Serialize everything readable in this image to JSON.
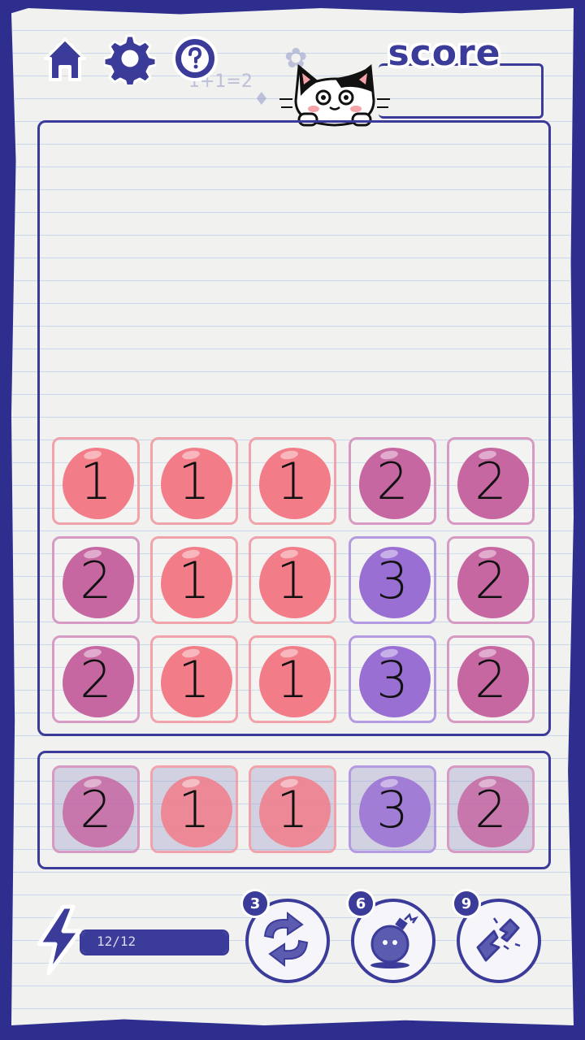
{
  "header": {
    "score_title": "score",
    "score_value": ""
  },
  "colors": {
    "frame": "#2e2e8f",
    "ink": "#3b3b99",
    "tile_1": "#f27c88",
    "tile_2": "#c667a2",
    "tile_3": "#9a6fd4"
  },
  "board": {
    "rows": [
      [
        "1",
        "1",
        "1",
        "2",
        "2"
      ],
      [
        "2",
        "1",
        "1",
        "3",
        "2"
      ],
      [
        "2",
        "1",
        "1",
        "3",
        "2"
      ]
    ]
  },
  "next_row": [
    "2",
    "1",
    "1",
    "3",
    "2"
  ],
  "energy": {
    "label": "12/12",
    "fraction": 1.0
  },
  "powerups": [
    {
      "name": "shuffle",
      "cost": "3",
      "icon": "shuffle-icon"
    },
    {
      "name": "bomb",
      "cost": "6",
      "icon": "bomb-icon"
    },
    {
      "name": "break",
      "cost": "9",
      "icon": "broken-block-icon"
    }
  ]
}
